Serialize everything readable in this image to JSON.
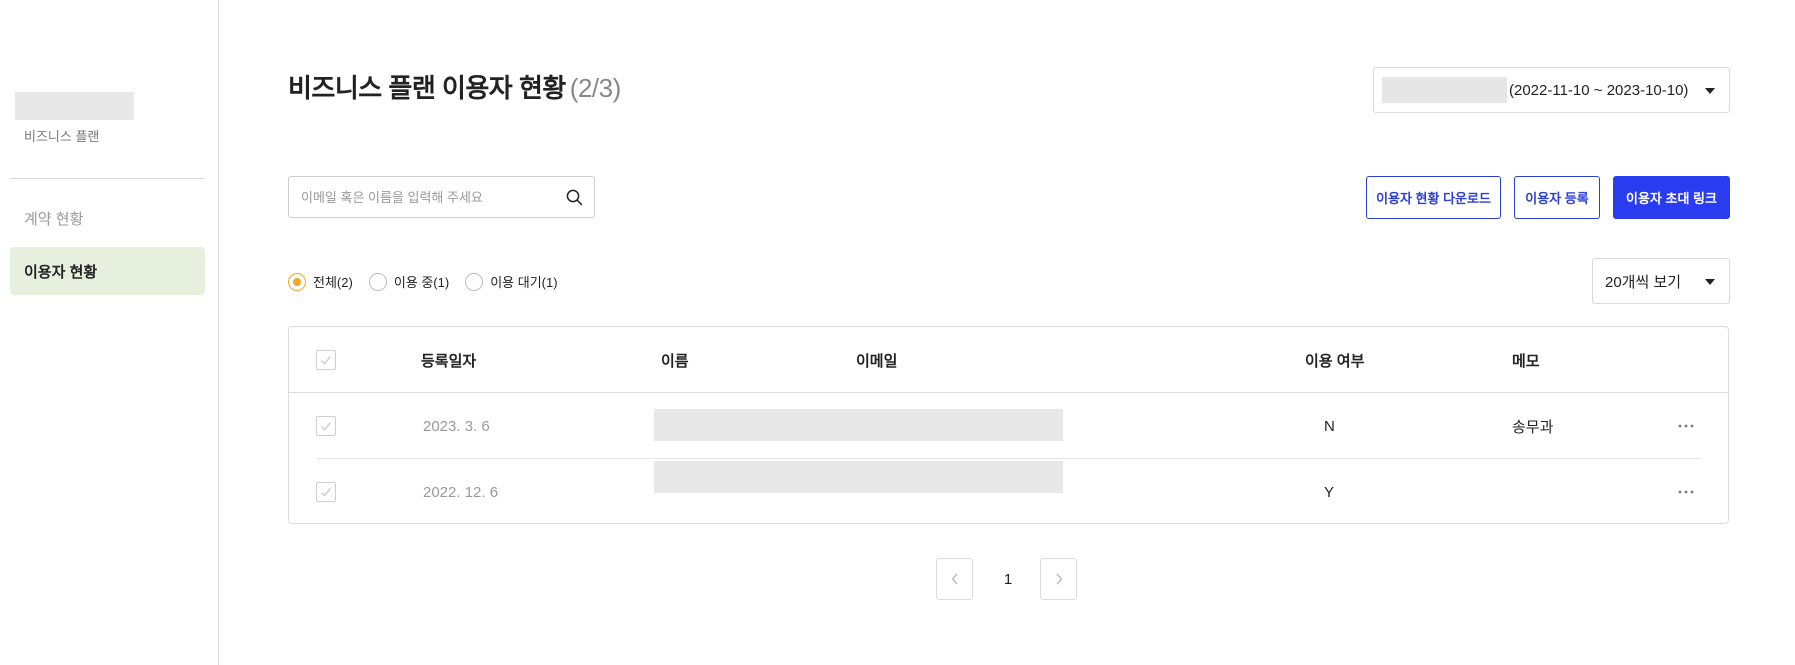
{
  "sidebar": {
    "org_plan": "비즈니스 플랜",
    "items": [
      {
        "label": "계약 현황"
      },
      {
        "label": "이용자 현황"
      }
    ]
  },
  "header": {
    "title": "비즈니스 플랜 이용자 현황",
    "count": "(2/3)",
    "period": "(2022-11-10 ~ 2023-10-10)"
  },
  "search": {
    "placeholder": "이메일 혹은 이름을 입력해 주세요",
    "value": ""
  },
  "actions": {
    "download_label": "이용자 현황 다운로드",
    "register_label": "이용자 등록",
    "invite_label": "이용자 초대 링크"
  },
  "filters": {
    "options": [
      {
        "label": "전체(2)",
        "selected": true
      },
      {
        "label": "이용 중(1)",
        "selected": false
      },
      {
        "label": "이용 대기(1)",
        "selected": false
      }
    ]
  },
  "page_size": {
    "value": "20개씩 보기"
  },
  "table": {
    "columns": [
      "등록일자",
      "이름",
      "이메일",
      "이용 여부",
      "메모"
    ],
    "rows": [
      {
        "date": "2023. 3. 6",
        "status": "N",
        "memo": "송무과"
      },
      {
        "date": "2022. 12. 6",
        "status": "Y",
        "memo": ""
      }
    ]
  },
  "pagination": {
    "current": "1"
  },
  "colors": {
    "primary": "#2a3cf0",
    "radio_selected": "#f0a828",
    "sidebar_active_bg": "#e7efdf"
  }
}
